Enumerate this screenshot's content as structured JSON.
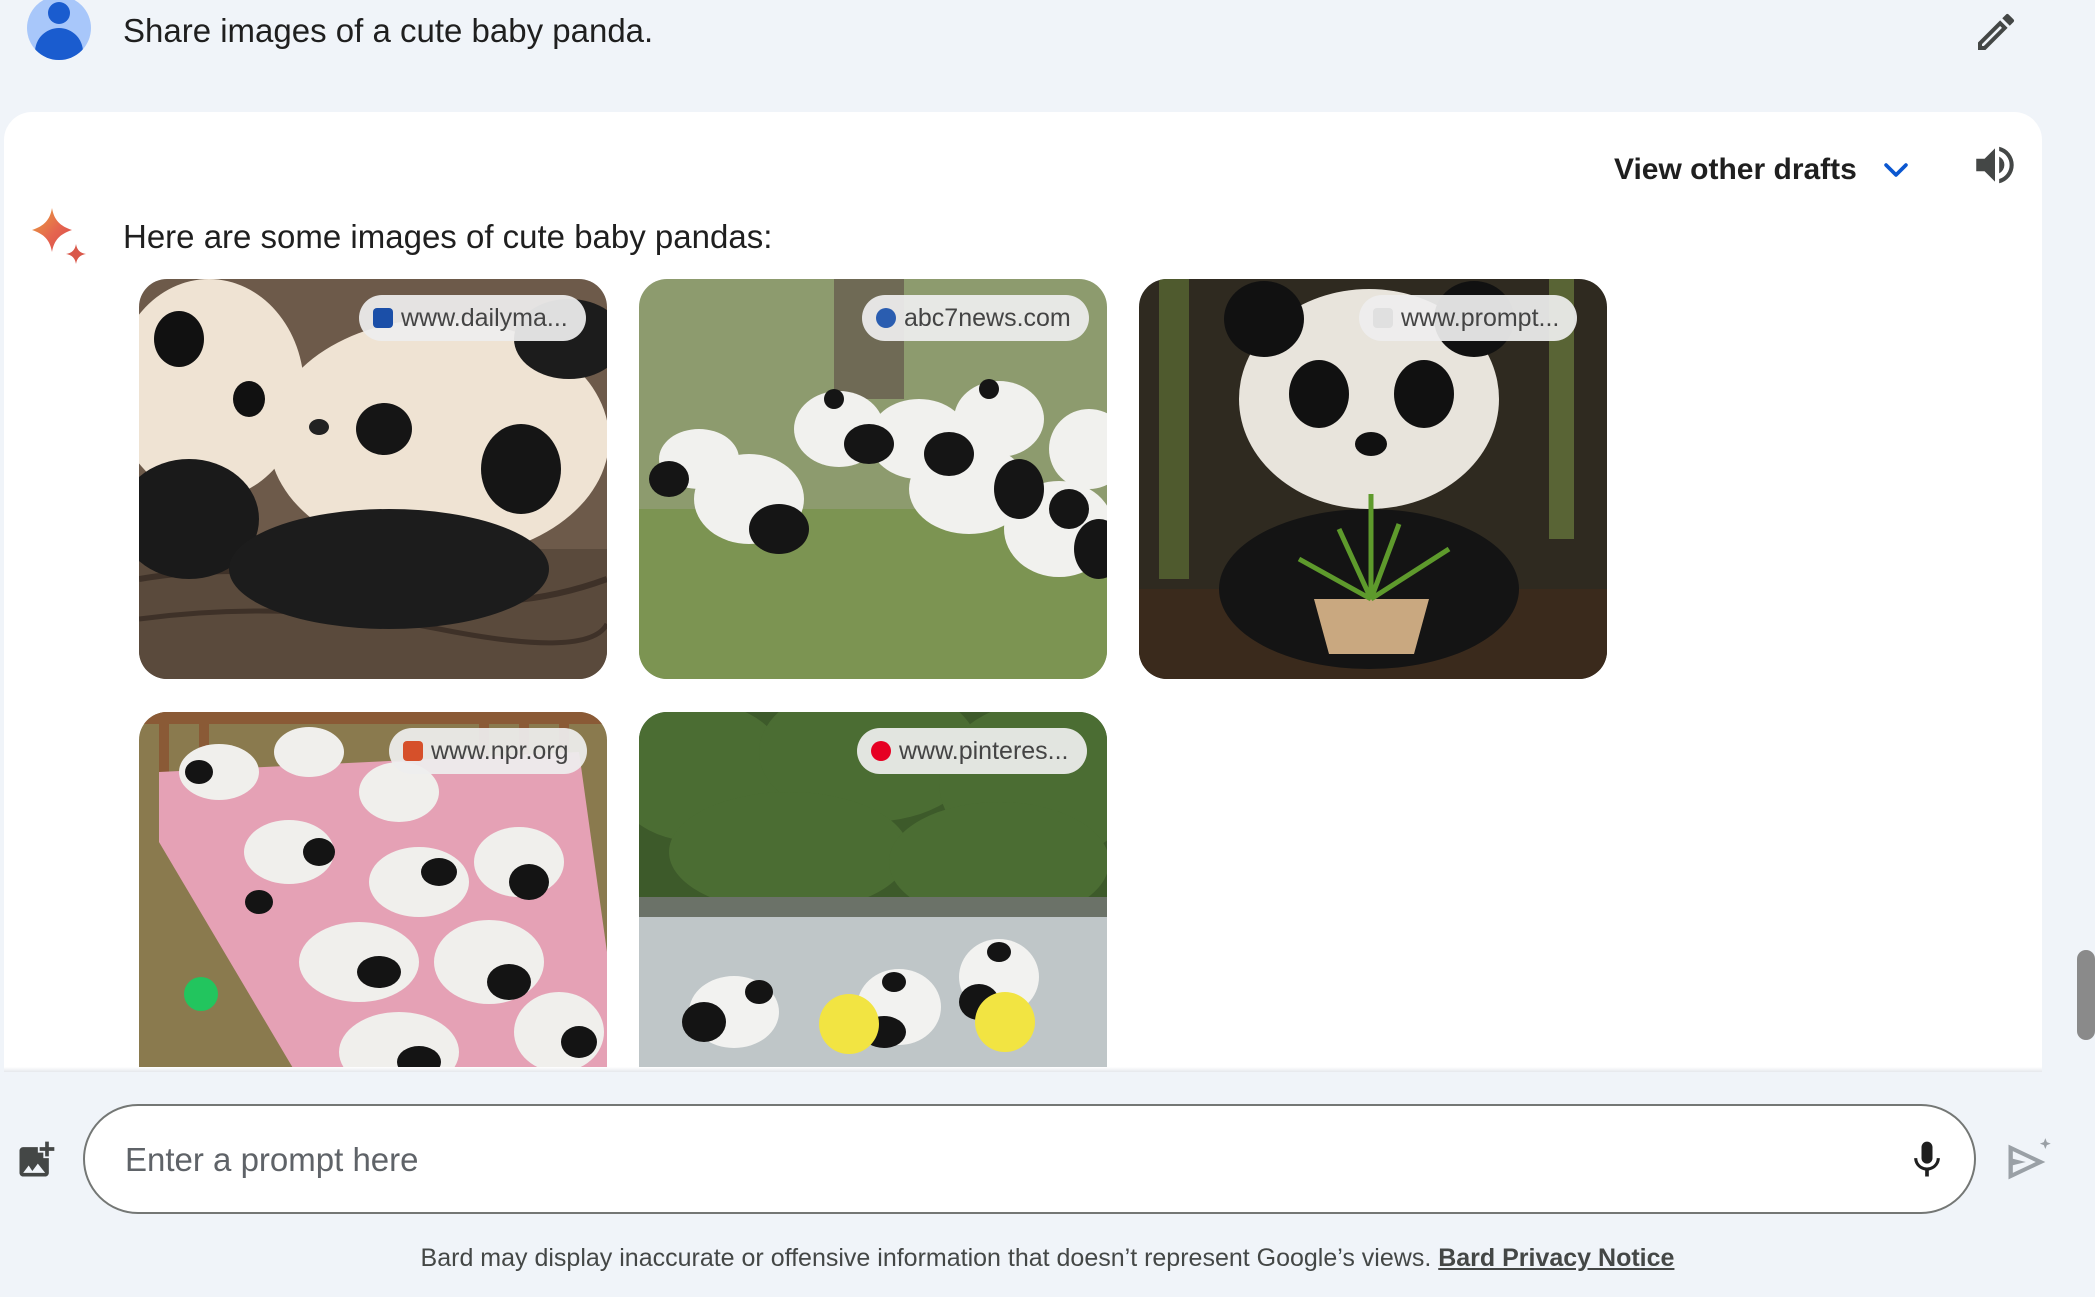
{
  "user": {
    "prompt": "Share images of a cute baby panda.",
    "avatar_icon": "person-icon",
    "edit_icon": "pencil-icon"
  },
  "response": {
    "drafts_label": "View other drafts",
    "drafts_icon": "chevron-down-icon",
    "speaker_icon": "volume-icon",
    "spark_icon": "sparkle-icon",
    "intro": "Here are some images of cute baby pandas:",
    "images": [
      {
        "source": "www.dailyma...",
        "favicon": "dailymail-icon"
      },
      {
        "source": "abc7news.com",
        "favicon": "abc7-icon"
      },
      {
        "source": "www.prompt...",
        "favicon": "prompthero-icon"
      },
      {
        "source": "www.npr.org",
        "favicon": "npr-icon"
      },
      {
        "source": "www.pinteres...",
        "favicon": "pinterest-icon"
      }
    ]
  },
  "input": {
    "placeholder": "Enter a prompt here",
    "add_image_icon": "add-image-icon",
    "mic_icon": "mic-icon",
    "send_icon": "send-icon"
  },
  "footer": {
    "disclaimer": "Bard may display inaccurate or offensive information that doesn’t represent Google’s views.",
    "privacy_link": "Bard Privacy Notice"
  },
  "colors": {
    "background": "#f0f4f9",
    "card": "#ffffff",
    "accent_blue": "#0b57d0",
    "text": "#1f1f1f"
  }
}
